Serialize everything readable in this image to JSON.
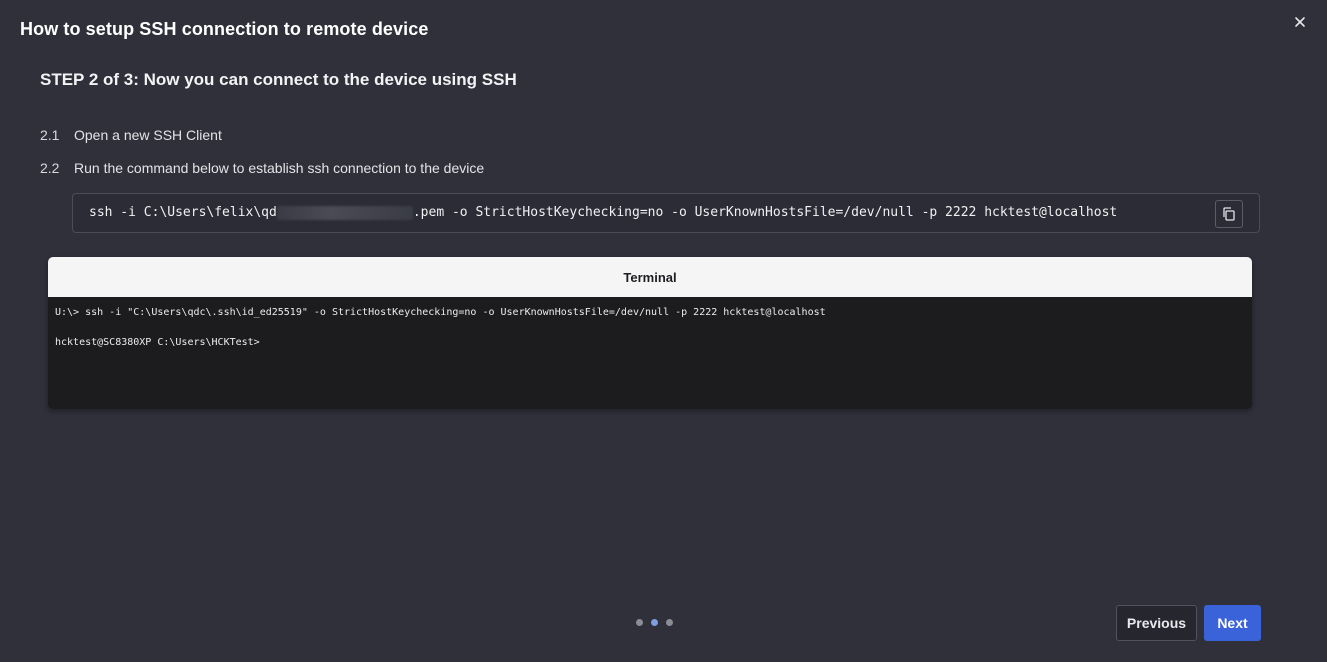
{
  "dialog": {
    "title": "How to setup SSH connection to remote device",
    "close_icon": "close-icon"
  },
  "step": {
    "heading": "STEP 2 of 3: Now you can connect to the device using SSH",
    "items": [
      {
        "number": "2.1",
        "text": "Open a new SSH Client"
      },
      {
        "number": "2.2",
        "text": "Run the command below to establish ssh connection to the device"
      }
    ]
  },
  "command": {
    "prefix": "ssh -i C:\\Users\\felix\\qd",
    "suffix": ".pem -o StrictHostKeychecking=no -o UserKnownHostsFile=/dev/null -p 2222 hcktest@localhost",
    "copy_icon": "copy-icon"
  },
  "terminal": {
    "title": "Terminal",
    "lines": [
      "U:\\> ssh -i \"C:\\Users\\qdc\\.ssh\\id_ed25519\" -o StrictHostKeychecking=no -o UserKnownHostsFile=/dev/null -p 2222 hcktest@localhost",
      "hcktest@SC8380XP C:\\Users\\HCKTest>"
    ]
  },
  "pager": {
    "total": 3,
    "current": 2
  },
  "buttons": {
    "previous": "Previous",
    "next": "Next"
  },
  "colors": {
    "accent": "#3b63d9",
    "background": "#2f303a",
    "terminal_bg": "#1c1c1f"
  }
}
